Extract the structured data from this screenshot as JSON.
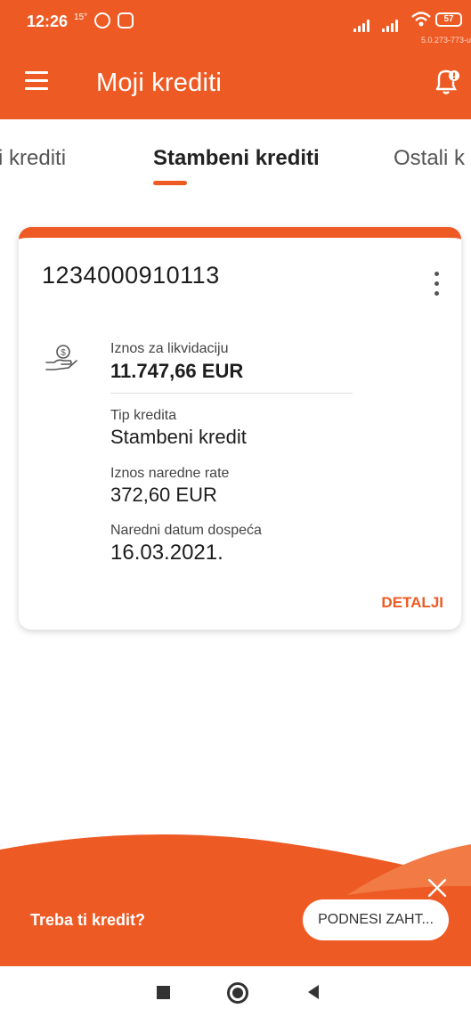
{
  "status_bar": {
    "time": "12:26",
    "temp": "15°",
    "battery": "57",
    "version": "5.0.273-773-u"
  },
  "app_bar": {
    "title": "Moji krediti",
    "icons": [
      "menu-icon",
      "notification-bell-icon"
    ]
  },
  "tabs": [
    {
      "label": "i krediti",
      "active": false
    },
    {
      "label": "Stambeni krediti",
      "active": true
    },
    {
      "label": "Ostali k",
      "active": false
    }
  ],
  "loan_card": {
    "account_number": "1234000910113",
    "liquidation_label": "Iznos za likvidaciju",
    "liquidation_value": "11.747,66 EUR",
    "type_label": "Tip kredita",
    "type_value": "Stambeni kredit",
    "next_installment_label": "Iznos naredne rate",
    "next_installment_value": "372,60 EUR",
    "due_date_label": "Naredni datum dospeća",
    "due_date_value": "16.03.2021.",
    "details_label": "DETALJI"
  },
  "banner": {
    "question": "Treba ti kredit?",
    "button_label": "PODNESI ZAHT..."
  },
  "colors": {
    "accent": "#ee5a24",
    "text": "#1d1d1d"
  }
}
